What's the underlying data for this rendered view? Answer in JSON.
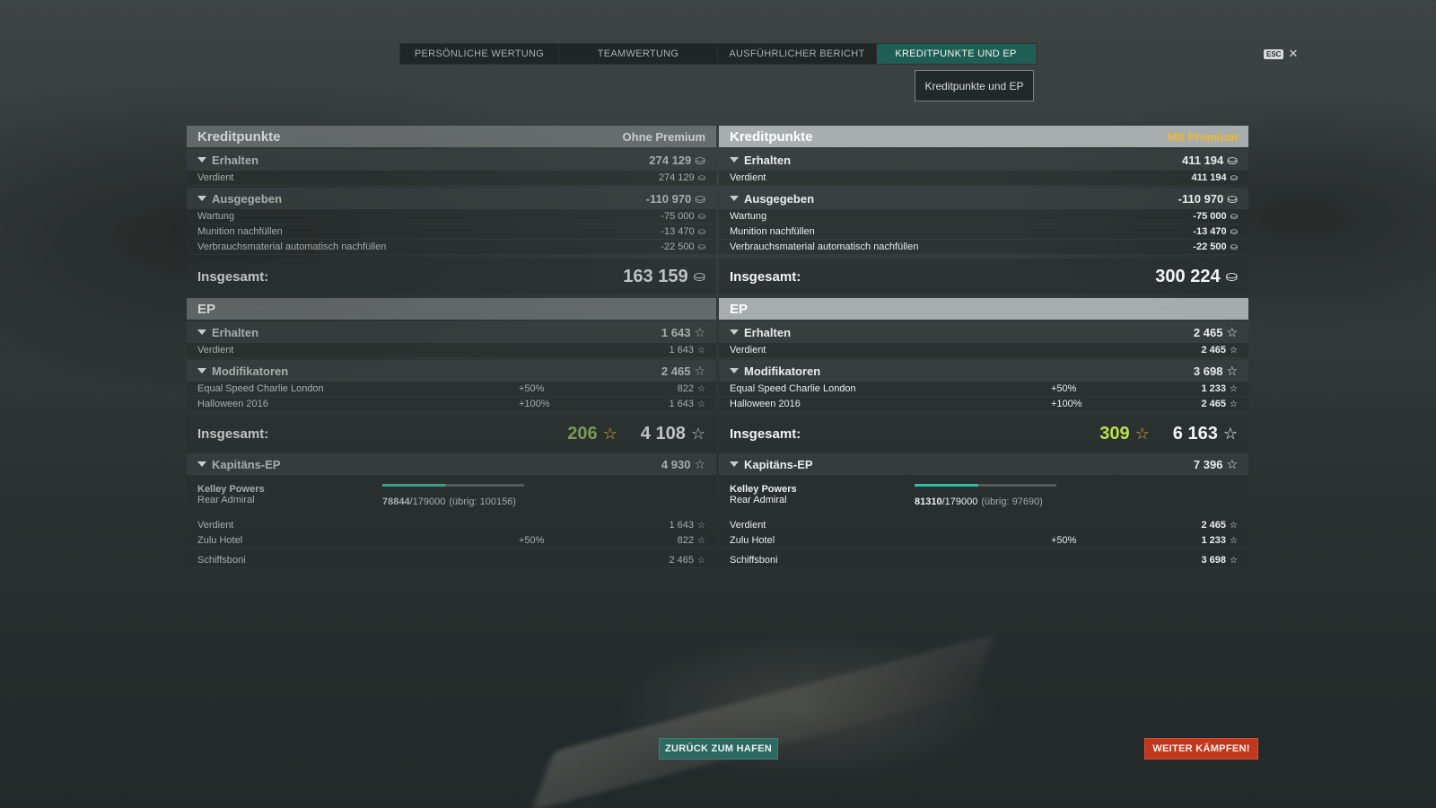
{
  "tabs": [
    {
      "label": "PERSÖNLICHE WERTUNG"
    },
    {
      "label": "TEAMWERTUNG"
    },
    {
      "label": "AUSFÜHRLICHER BERICHT"
    },
    {
      "label": "KREDITPUNKTE UND EP"
    }
  ],
  "tooltip": "Kreditpunkte und EP",
  "esc_label": "ESC",
  "left": {
    "credits_title": "Kreditpunkte",
    "premium_label": "Ohne Premium",
    "received_label": "Erhalten",
    "received_value": "274 129",
    "earned_label": "Verdient",
    "earned_value": "274 129",
    "spent_label": "Ausgegeben",
    "spent_value": "-110 970",
    "maintenance_label": "Wartung",
    "maintenance_value": "-75 000",
    "ammo_label": "Munition nachfüllen",
    "ammo_value": "-13 470",
    "consumables_label": "Verbrauchsmaterial automatisch nachfüllen",
    "consumables_value": "-22 500",
    "credits_total_label": "Insgesamt:",
    "credits_total_value": "163 159",
    "ep_title": "EP",
    "ep_received_label": "Erhalten",
    "ep_received_value": "1 643",
    "ep_earned_label": "Verdient",
    "ep_earned_value": "1 643",
    "modifiers_label": "Modifikatoren",
    "modifiers_value": "2 465",
    "mod1_label": "Equal Speed Charlie London",
    "mod1_pct": "+50%",
    "mod1_value": "822",
    "mod2_label": "Halloween 2016",
    "mod2_pct": "+100%",
    "mod2_value": "1 643",
    "ep_total_label": "Insgesamt:",
    "ep_total_free": "206",
    "ep_total_value": "4 108",
    "captain_label": "Kapitäns-EP",
    "captain_value": "4 930",
    "captain_name": "Kelley Powers",
    "captain_rank": "Rear Admiral",
    "captain_xp_current": "78844",
    "captain_xp_max": "/179000",
    "captain_xp_rest": "(übrig: 100156)",
    "captain_progress": 0.44,
    "cap_earned_label": "Verdient",
    "cap_earned_value": "1 643",
    "cap_flag_label": "Zulu Hotel",
    "cap_flag_pct": "+50%",
    "cap_flag_value": "822",
    "cap_ship_label": "Schiffsboni",
    "cap_ship_value": "2 465"
  },
  "right": {
    "credits_title": "Kreditpunkte",
    "premium_label": "Mit Premium",
    "received_label": "Erhalten",
    "received_value": "411 194",
    "earned_label": "Verdient",
    "earned_value": "411 194",
    "spent_label": "Ausgegeben",
    "spent_value": "-110 970",
    "maintenance_label": "Wartung",
    "maintenance_value": "-75 000",
    "ammo_label": "Munition nachfüllen",
    "ammo_value": "-13 470",
    "consumables_label": "Verbrauchsmaterial automatisch nachfüllen",
    "consumables_value": "-22 500",
    "credits_total_label": "Insgesamt:",
    "credits_total_value": "300 224",
    "ep_title": "EP",
    "ep_received_label": "Erhalten",
    "ep_received_value": "2 465",
    "ep_earned_label": "Verdient",
    "ep_earned_value": "2 465",
    "modifiers_label": "Modifikatoren",
    "modifiers_value": "3 698",
    "mod1_label": "Equal Speed Charlie London",
    "mod1_pct": "+50%",
    "mod1_value": "1 233",
    "mod2_label": "Halloween 2016",
    "mod2_pct": "+100%",
    "mod2_value": "2 465",
    "ep_total_label": "Insgesamt:",
    "ep_total_free": "309",
    "ep_total_value": "6 163",
    "captain_label": "Kapitäns-EP",
    "captain_value": "7 396",
    "captain_name": "Kelley Powers",
    "captain_rank": "Rear Admiral",
    "captain_xp_current": "81310",
    "captain_xp_max": "/179000",
    "captain_xp_rest": "(übrig: 97690)",
    "captain_progress": 0.45,
    "cap_earned_label": "Verdient",
    "cap_earned_value": "2 465",
    "cap_flag_label": "Zulu Hotel",
    "cap_flag_pct": "+50%",
    "cap_flag_value": "1 233",
    "cap_ship_label": "Schiffsboni",
    "cap_ship_value": "3 698"
  },
  "buttons": {
    "back_to_port": "ZURÜCK ZUM HAFEN",
    "keep_fighting": "WEITER KÄMPFEN!"
  },
  "colors": {
    "active_tab": "#1f5e55",
    "premium_gold": "#f0b830",
    "free_xp_green": "#b9e24b",
    "fight_button": "#c2381e",
    "port_button": "#2c6a61"
  },
  "icons": {
    "credit": "credit-coin-icon",
    "xp": "xp-star-icon",
    "free_xp": "free-xp-star-icon",
    "collapse": "triangle-down-icon",
    "close": "close-icon"
  }
}
